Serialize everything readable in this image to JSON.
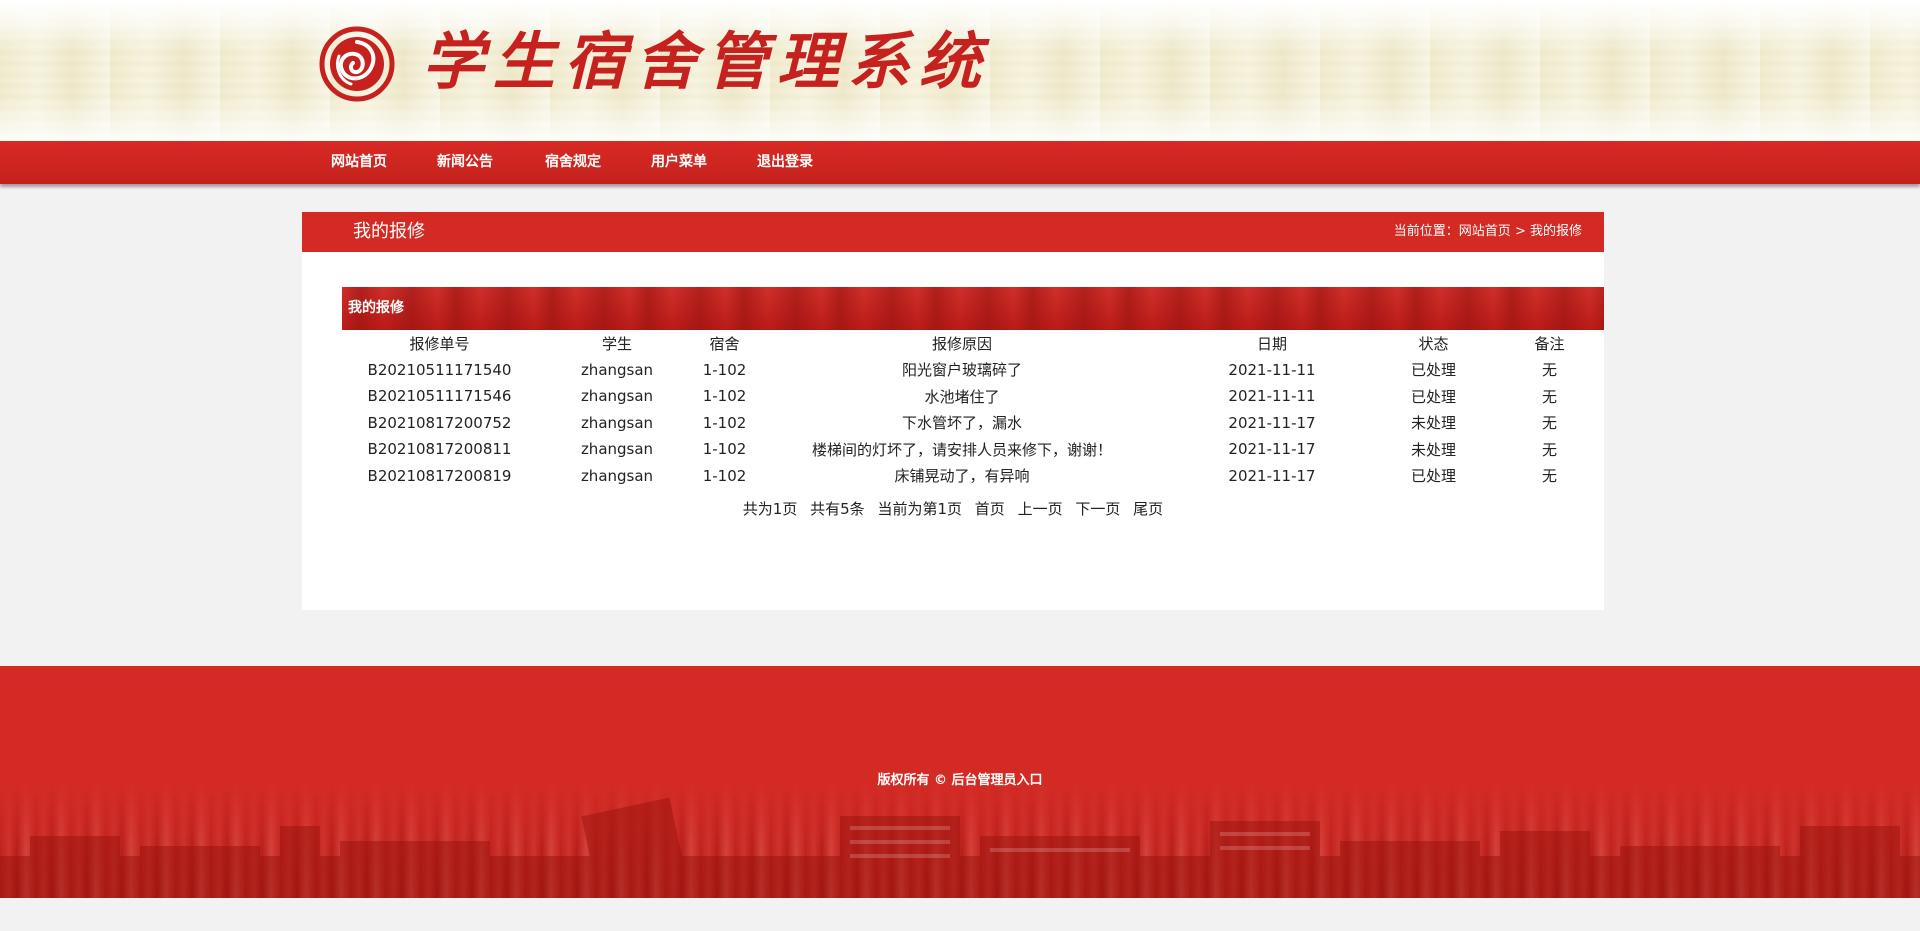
{
  "header": {
    "site_title": "学生宿舍管理系统",
    "logo_icon": "red-seal-logo-icon"
  },
  "nav": {
    "items": [
      {
        "label": "网站首页"
      },
      {
        "label": "新闻公告"
      },
      {
        "label": "宿舍规定"
      },
      {
        "label": "用户菜单"
      },
      {
        "label": "退出登录"
      }
    ]
  },
  "page": {
    "title": "我的报修",
    "breadcrumb_prefix": "当前位置：",
    "breadcrumb_home": "网站首页",
    "breadcrumb_sep": ">",
    "breadcrumb_current": "我的报修"
  },
  "section": {
    "title": "我的报修"
  },
  "table": {
    "columns": [
      "报修单号",
      "学生",
      "宿舍",
      "报修原因",
      "日期",
      "状态",
      "备注"
    ],
    "rows": [
      [
        "B20210511171540",
        "zhangsan",
        "1-102",
        "阳光窗户玻璃碎了",
        "2021-11-11",
        "已处理",
        "无"
      ],
      [
        "B20210511171546",
        "zhangsan",
        "1-102",
        "水池堵住了",
        "2021-11-11",
        "已处理",
        "无"
      ],
      [
        "B20210817200752",
        "zhangsan",
        "1-102",
        "下水管坏了，漏水",
        "2021-11-17",
        "未处理",
        "无"
      ],
      [
        "B20210817200811",
        "zhangsan",
        "1-102",
        "楼梯间的灯坏了，请安排人员来修下，谢谢！",
        "2021-11-17",
        "未处理",
        "无"
      ],
      [
        "B20210817200819",
        "zhangsan",
        "1-102",
        "床铺晃动了，有异响",
        "2021-11-17",
        "已处理",
        "无"
      ]
    ]
  },
  "pager": {
    "total_pages": "共为1页",
    "total_items": "共有5条",
    "current_page": "当前为第1页",
    "first": "首页",
    "prev": "上一页",
    "next": "下一页",
    "last": "尾页"
  },
  "footer": {
    "copyright": "版权所有 ©",
    "admin_link": "后台管理员入口"
  },
  "colors": {
    "brand_red": "#d42a24",
    "page_bg": "#f2f2f2"
  }
}
